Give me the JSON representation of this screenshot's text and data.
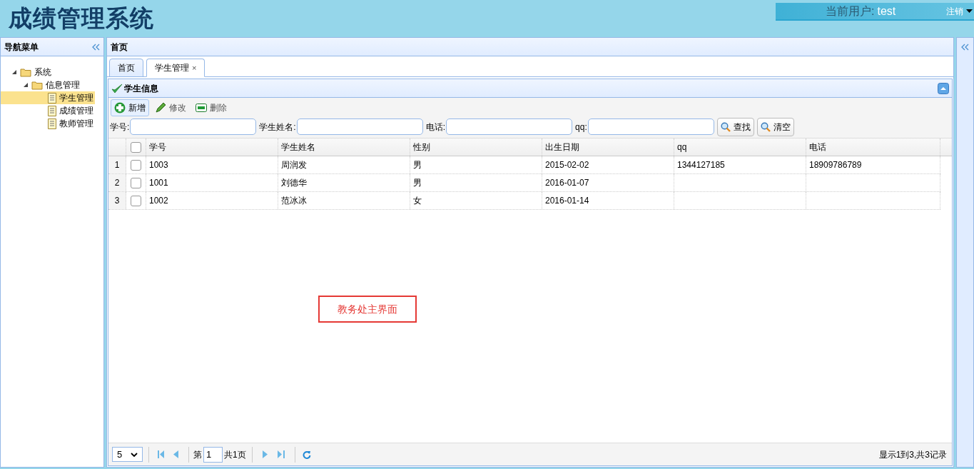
{
  "header": {
    "title": "成绩管理系统",
    "user_label": "当前用户:",
    "user_name": "test",
    "logout": "注销"
  },
  "sidebar": {
    "title": "导航菜单",
    "tree": [
      {
        "label": "系统",
        "expanded": true,
        "selected": false,
        "children": [
          {
            "label": "信息管理",
            "expanded": true,
            "selected": false,
            "children": [
              {
                "label": "学生管理",
                "selected": true
              },
              {
                "label": "成绩管理",
                "selected": false
              },
              {
                "label": "教师管理",
                "selected": false
              }
            ]
          }
        ]
      }
    ]
  },
  "main": {
    "title": "首页",
    "tabs": [
      {
        "label": "首页",
        "selected": false,
        "closable": false
      },
      {
        "label": "学生管理",
        "selected": true,
        "closable": true,
        "close": "×"
      }
    ],
    "panel_title": "学生信息",
    "toolbar": [
      {
        "kind": "add",
        "label": "新增",
        "selected": true
      },
      {
        "kind": "edit",
        "label": "修改",
        "selected": false
      },
      {
        "kind": "remove",
        "label": "删除",
        "selected": false
      }
    ],
    "search": [
      {
        "label": "学号:"
      },
      {
        "label": "学生姓名:"
      },
      {
        "label": "电话:"
      },
      {
        "label": "qq:"
      }
    ],
    "search_buttons": [
      "查找",
      "清空"
    ],
    "table": {
      "all_checked": false,
      "columns": [
        "学号",
        "学生姓名",
        "性别",
        "出生日期",
        "qq",
        "电话"
      ],
      "rows": [
        {
          "index": "1",
          "checked": false,
          "cells": [
            "1003",
            "周润发",
            "男",
            "2015-02-02",
            "1344127185",
            "18909786789"
          ]
        },
        {
          "index": "2",
          "checked": false,
          "cells": [
            "1001",
            "刘德华",
            "男",
            "2016-01-07",
            null,
            null
          ]
        },
        {
          "index": "3",
          "checked": false,
          "cells": [
            "1002",
            "范冰冰",
            "女",
            "2016-01-14",
            null,
            null
          ]
        }
      ]
    },
    "annotation": "教务处主界面",
    "pager": {
      "page_size": "5",
      "page_prefix": "第",
      "page": "1",
      "page_suffix": "共1页",
      "summary": "显示1到3,共3记录"
    }
  }
}
